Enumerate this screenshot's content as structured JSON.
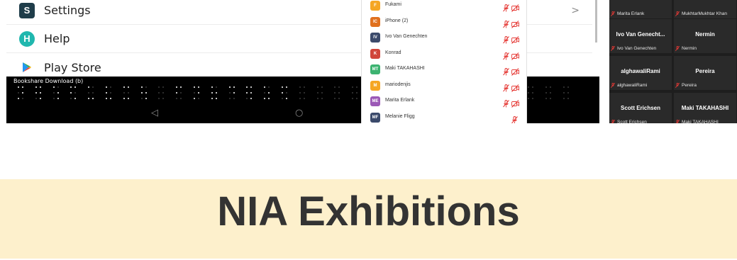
{
  "android_menu": {
    "items": [
      {
        "label": "Settings",
        "icon": "settings-s-icon",
        "glyph": "S",
        "chevron": ">"
      },
      {
        "label": "Help",
        "icon": "help-h-icon",
        "glyph": "H"
      },
      {
        "label": "Play Store",
        "icon": "play-store-icon"
      }
    ]
  },
  "braille_display": {
    "title": "Bookshare Download (b)",
    "nav_back": "◁",
    "nav_home": "○"
  },
  "participants": [
    {
      "initials": "F",
      "name": "Fukami",
      "color": "#f5a623",
      "camera": true
    },
    {
      "initials": "IC",
      "name": "iPhone (2)",
      "color": "#e0701e",
      "camera": true
    },
    {
      "initials": "IV",
      "name": "Ivo Van Genechten",
      "color": "#3b4a6b",
      "camera": true
    },
    {
      "initials": "K",
      "name": "Konrad",
      "color": "#d0453a",
      "camera": true
    },
    {
      "initials": "MT",
      "name": "Maki TAKAHASHI",
      "color": "#3cb371",
      "camera": true
    },
    {
      "initials": "M",
      "name": "mariodenjis",
      "color": "#f5a623",
      "camera": true
    },
    {
      "initials": "ME",
      "name": "Marita Erlank",
      "color": "#9b59b6",
      "camera": true
    },
    {
      "initials": "MF",
      "name": "Melanie Fligg",
      "color": "#3b4a6b",
      "camera": false
    }
  ],
  "video_tiles": [
    {
      "name": "",
      "label": "Marita Erlank"
    },
    {
      "name": "",
      "label": "MukhtarMukhtar Khan"
    },
    {
      "name": "Ivo Van Genecht...",
      "label": "Ivo Van Genechten"
    },
    {
      "name": "Nermin",
      "label": "Nermin"
    },
    {
      "name": "alghawaliRami",
      "label": "alghawaliRami"
    },
    {
      "name": "Pereira",
      "label": "Pereira"
    },
    {
      "name": "Scott Erichsen",
      "label": "Scott Erichsen"
    },
    {
      "name": "Maki TAKAHASHI",
      "label": "Maki TAKAHASHI"
    }
  ],
  "banner": {
    "title": "NIA Exhibitions"
  },
  "colors": {
    "banner_bg": "#fdf0cc",
    "muted_red": "#e53935",
    "video_bg": "#1e1e1e"
  }
}
